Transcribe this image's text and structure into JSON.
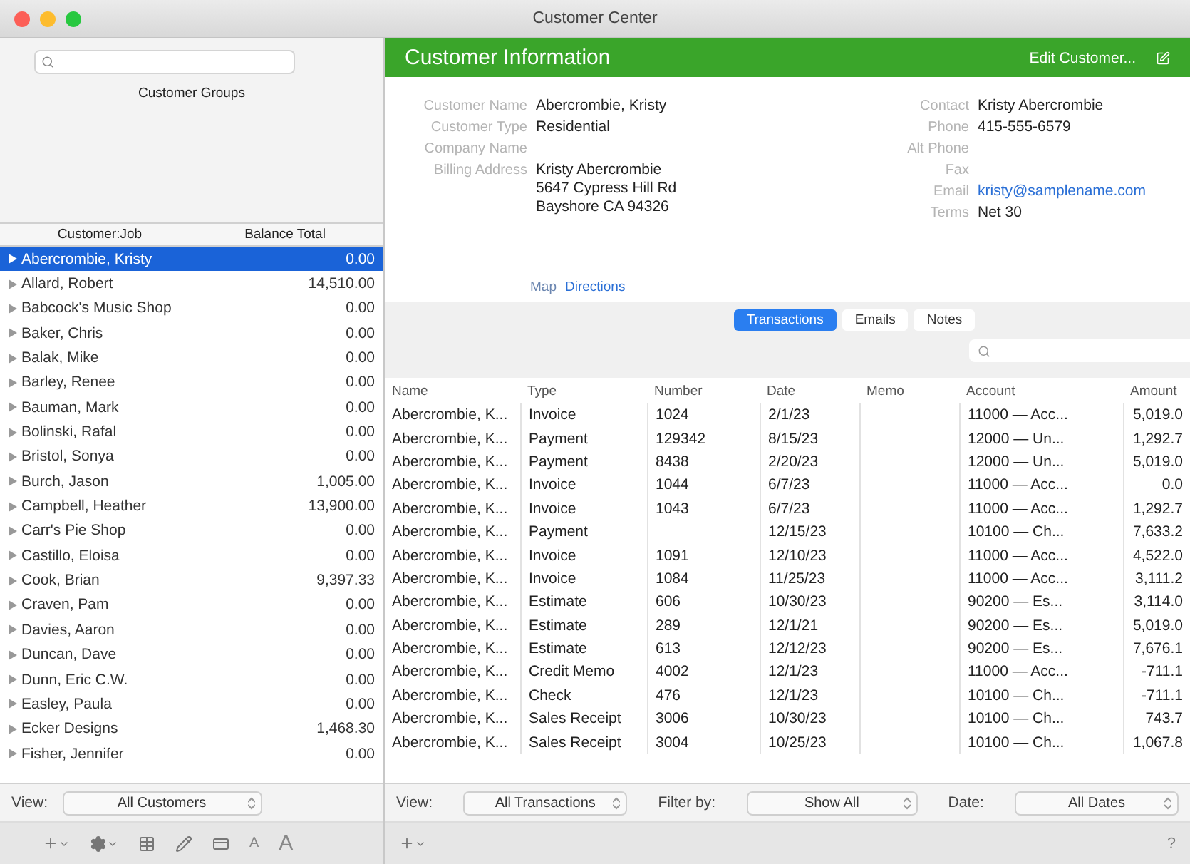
{
  "window": {
    "title": "Customer Center"
  },
  "sidebar": {
    "group_heading": "Customer Groups",
    "columns": [
      "Customer:Job",
      "Balance Total"
    ],
    "customers": [
      {
        "name": "Abercrombie, Kristy",
        "balance": "0.00",
        "selected": true
      },
      {
        "name": "Allard, Robert",
        "balance": "14,510.00",
        "selected": false
      },
      {
        "name": "Babcock's Music Shop",
        "balance": "0.00",
        "selected": false
      },
      {
        "name": "Baker, Chris",
        "balance": "0.00",
        "selected": false
      },
      {
        "name": "Balak, Mike",
        "balance": "0.00",
        "selected": false
      },
      {
        "name": "Barley, Renee",
        "balance": "0.00",
        "selected": false
      },
      {
        "name": "Bauman, Mark",
        "balance": "0.00",
        "selected": false
      },
      {
        "name": "Bolinski, Rafal",
        "balance": "0.00",
        "selected": false
      },
      {
        "name": "Bristol, Sonya",
        "balance": "0.00",
        "selected": false
      },
      {
        "name": "Burch, Jason",
        "balance": "1,005.00",
        "selected": false
      },
      {
        "name": "Campbell, Heather",
        "balance": "13,900.00",
        "selected": false
      },
      {
        "name": "Carr's Pie Shop",
        "balance": "0.00",
        "selected": false
      },
      {
        "name": "Castillo, Eloisa",
        "balance": "0.00",
        "selected": false
      },
      {
        "name": "Cook, Brian",
        "balance": "9,397.33",
        "selected": false
      },
      {
        "name": "Craven, Pam",
        "balance": "0.00",
        "selected": false
      },
      {
        "name": "Davies, Aaron",
        "balance": "0.00",
        "selected": false
      },
      {
        "name": "Duncan, Dave",
        "balance": "0.00",
        "selected": false
      },
      {
        "name": "Dunn, Eric C.W.",
        "balance": "0.00",
        "selected": false
      },
      {
        "name": "Easley, Paula",
        "balance": "0.00",
        "selected": false
      },
      {
        "name": "Ecker Designs",
        "balance": "1,468.30",
        "selected": false
      },
      {
        "name": "Fisher, Jennifer",
        "balance": "0.00",
        "selected": false
      }
    ],
    "view": {
      "label": "View:",
      "value": "All Customers"
    },
    "text_buttons": [
      "A",
      "A"
    ]
  },
  "header": {
    "title": "Customer Information",
    "edit_button": "Edit Customer..."
  },
  "info": {
    "left": [
      {
        "label": "Customer Name",
        "lines": [
          "Abercrombie, Kristy"
        ]
      },
      {
        "label": "Customer Type",
        "lines": [
          "Residential"
        ]
      },
      {
        "label": "Company Name"
      },
      {
        "label": "Billing Address",
        "lines": [
          "Kristy Abercrombie",
          "5647 Cypress Hill Rd",
          "Bayshore CA 94326"
        ]
      }
    ],
    "right": [
      {
        "label": "Contact",
        "lines": [
          "Kristy Abercrombie"
        ],
        "kind": "text"
      },
      {
        "label": "Phone",
        "lines": [
          "415-555-6579"
        ],
        "kind": "text"
      },
      {
        "label": "Alt Phone"
      },
      {
        "label": "Fax"
      },
      {
        "label": "Email",
        "lines": [
          "kristy@samplename.com"
        ],
        "kind": "link"
      },
      {
        "label": "Terms",
        "lines": [
          "Net 30"
        ],
        "kind": "text"
      }
    ],
    "map_label": "Map",
    "directions_link": "Directions"
  },
  "tabs": [
    {
      "label": "Transactions",
      "selected": true
    },
    {
      "label": "Emails",
      "selected": false
    },
    {
      "label": "Notes",
      "selected": false
    }
  ],
  "table": {
    "columns": [
      "Name",
      "Type",
      "Number",
      "Date",
      "Memo",
      "Account",
      "Amount"
    ],
    "rows": [
      [
        "Abercrombie, K...",
        "Invoice",
        "1024",
        "2/1/23",
        "",
        "11000 — Acc...",
        "5,019.0"
      ],
      [
        "Abercrombie, K...",
        "Payment",
        "129342",
        "8/15/23",
        "",
        "12000 — Un...",
        "1,292.7"
      ],
      [
        "Abercrombie, K...",
        "Payment",
        "8438",
        "2/20/23",
        "",
        "12000 — Un...",
        "5,019.0"
      ],
      [
        "Abercrombie, K...",
        "Invoice",
        "1044",
        "6/7/23",
        "",
        "11000 — Acc...",
        "0.0"
      ],
      [
        "Abercrombie, K...",
        "Invoice",
        "1043",
        "6/7/23",
        "",
        "11000 — Acc...",
        "1,292.7"
      ],
      [
        "Abercrombie, K...",
        "Payment",
        "",
        "12/15/23",
        "",
        "10100 — Ch...",
        "7,633.2"
      ],
      [
        "Abercrombie, K...",
        "Invoice",
        "1091",
        "12/10/23",
        "",
        "11000 — Acc...",
        "4,522.0"
      ],
      [
        "Abercrombie, K...",
        "Invoice",
        "1084",
        "11/25/23",
        "",
        "11000 — Acc...",
        "3,111.2"
      ],
      [
        "Abercrombie, K...",
        "Estimate",
        "606",
        "10/30/23",
        "",
        "90200 — Es...",
        "3,114.0"
      ],
      [
        "Abercrombie, K...",
        "Estimate",
        "289",
        "12/1/21",
        "",
        "90200 — Es...",
        "5,019.0"
      ],
      [
        "Abercrombie, K...",
        "Estimate",
        "613",
        "12/12/23",
        "",
        "90200 — Es...",
        "7,676.1"
      ],
      [
        "Abercrombie, K...",
        "Credit Memo",
        "4002",
        "12/1/23",
        "",
        "11000 — Acc...",
        "-711.1"
      ],
      [
        "Abercrombie, K...",
        "Check",
        "476",
        "12/1/23",
        "",
        "10100 — Ch...",
        "-711.1"
      ],
      [
        "Abercrombie, K...",
        "Sales Receipt",
        "3006",
        "10/30/23",
        "",
        "10100 — Ch...",
        "743.7"
      ],
      [
        "Abercrombie, K...",
        "Sales Receipt",
        "3004",
        "10/25/23",
        "",
        "10100 — Ch...",
        "1,067.8"
      ]
    ]
  },
  "filters": [
    {
      "label": "View:",
      "value": "All Transactions"
    },
    {
      "label": "Filter by:",
      "value": "Show All"
    },
    {
      "label": "Date:",
      "value": "All Dates"
    }
  ],
  "help": "?"
}
